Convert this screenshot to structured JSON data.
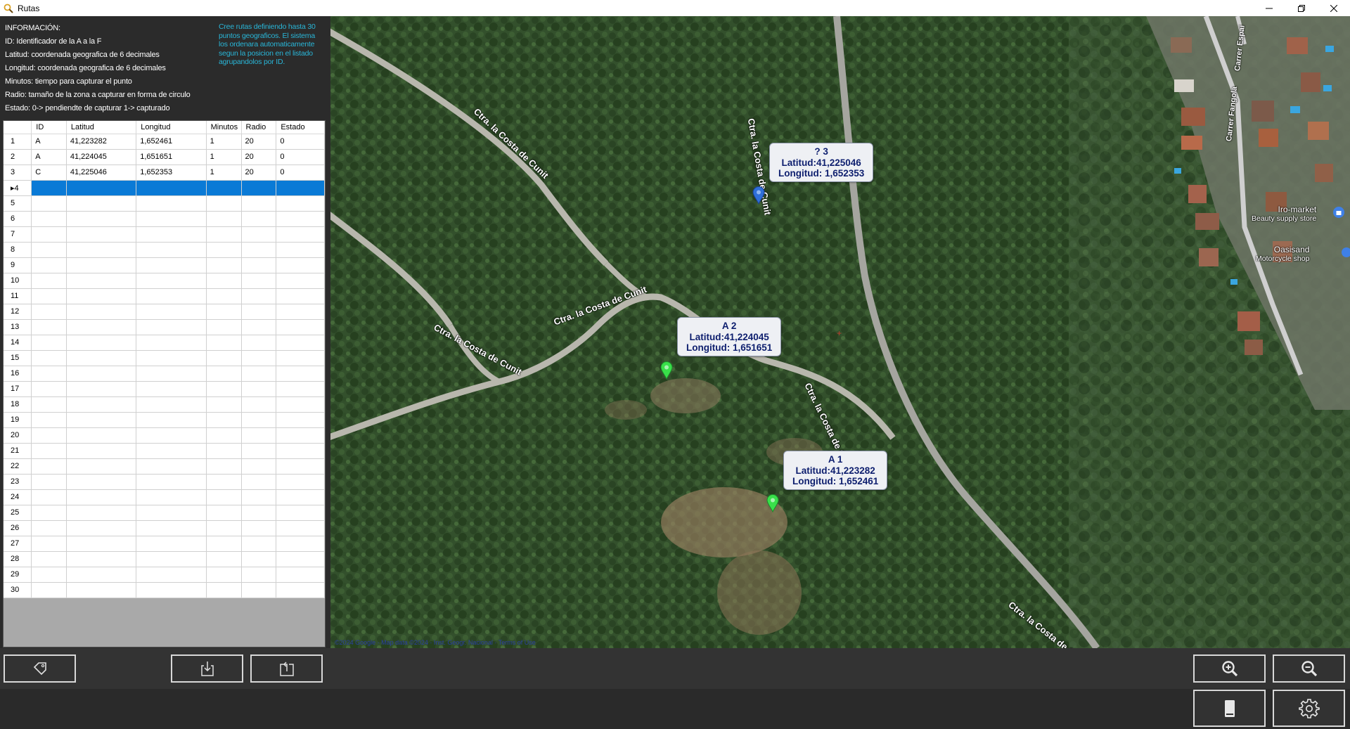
{
  "window": {
    "title": "Rutas",
    "minimize_label": "—",
    "restore_label": "❐",
    "close_label": "✕"
  },
  "info": {
    "lines": [
      "INFORMACIÓN:",
      "ID: Identificador de la A a la F",
      "Latitud: coordenada geografica de 6 decimales",
      "Longitud: coordenada geografica de 6 decimales",
      "Minutos: tiempo para capturar el punto",
      "Radio: tamaño de la zona a capturar en forma de circulo",
      "Estado: 0-> pendiendte de capturar 1-> capturado"
    ],
    "note": "Cree rutas definiendo hasta 30 puntos geograficos. El sistema los ordenara automaticamente segun la posicion en el listado agrupandolos por ID."
  },
  "grid": {
    "columns": [
      "ID",
      "Latitud",
      "Longitud",
      "Minutos",
      "Radio",
      "Estado"
    ],
    "rows": [
      {
        "n": "1",
        "id": "A",
        "lat": "41,223282",
        "lon": "1,652461",
        "min": "1",
        "radio": "20",
        "estado": "0"
      },
      {
        "n": "2",
        "id": "A",
        "lat": "41,224045",
        "lon": "1,651651",
        "min": "1",
        "radio": "20",
        "estado": "0"
      },
      {
        "n": "3",
        "id": "C",
        "lat": "41,225046",
        "lon": "1,652353",
        "min": "1",
        "radio": "20",
        "estado": "0"
      },
      {
        "n": "▸4",
        "id": "",
        "lat": "",
        "lon": "",
        "min": "",
        "radio": "",
        "estado": ""
      },
      {
        "n": "5"
      },
      {
        "n": "6"
      },
      {
        "n": "7"
      },
      {
        "n": "8"
      },
      {
        "n": "9"
      },
      {
        "n": "10"
      },
      {
        "n": "11"
      },
      {
        "n": "12"
      },
      {
        "n": "13"
      },
      {
        "n": "14"
      },
      {
        "n": "15"
      },
      {
        "n": "16"
      },
      {
        "n": "17"
      },
      {
        "n": "18"
      },
      {
        "n": "19"
      },
      {
        "n": "20"
      },
      {
        "n": "21"
      },
      {
        "n": "22"
      },
      {
        "n": "23"
      },
      {
        "n": "24"
      },
      {
        "n": "25"
      },
      {
        "n": "26"
      },
      {
        "n": "27"
      },
      {
        "n": "28"
      },
      {
        "n": "29"
      },
      {
        "n": "30"
      }
    ],
    "selected_row": 4
  },
  "map": {
    "popups": [
      {
        "title": "? 3",
        "lat": "Latitud:41,225046",
        "lon": "Longitud: 1,652353"
      },
      {
        "title": "A 2",
        "lat": "Latitud:41,224045",
        "lon": "Longitud: 1,651651"
      },
      {
        "title": "A 1",
        "lat": "Latitud:41,223282",
        "lon": "Longitud: 1,652461"
      }
    ],
    "markers": [
      {
        "name": "marker-3",
        "color": "#2f6fd8"
      },
      {
        "name": "marker-2",
        "color": "#39e04a"
      },
      {
        "name": "marker-1",
        "color": "#39e04a"
      }
    ],
    "road_labels": [
      "Ctra. la Costa de Cunit",
      "Ctra. la Costa de Cunit",
      "Ctra. la Costa de Cunit",
      "Ctra. la Costa de Cunit",
      "Ctra. la Costa de Cunit",
      "Ctra. la Costa de Cunit",
      "Carrer Fangola",
      "Carrer Espai"
    ],
    "pois": [
      {
        "name": "Iro-market",
        "sub": "Beauty supply store"
      },
      {
        "name": "Oasisand",
        "sub": "Motorcycle shop"
      }
    ],
    "attribution": "©2024 Google · Map data ©2024 · Inst. Geogr. Nacional · Terms of Use"
  },
  "toolbar": {
    "icons": [
      "tag-icon",
      "import-icon",
      "export-icon",
      "zoom-in-icon",
      "zoom-out-icon",
      "device-icon",
      "settings-icon"
    ]
  },
  "colors": {
    "background": "#2b2b2b",
    "note_text": "#29b6d8",
    "selection": "#0a7ad6",
    "popup_text": "#0d1e6e",
    "marker_blue": "#2f6fd8",
    "marker_green": "#39e04a"
  }
}
